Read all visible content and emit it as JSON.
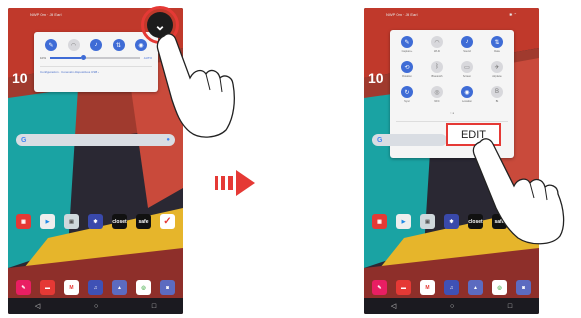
{
  "left_screen": {
    "status_left": "NWP 0m · Jil Earl",
    "clock": "10",
    "quick_settings": [
      {
        "icon": "pencil-icon",
        "on": true
      },
      {
        "icon": "wifi-icon",
        "on": false
      },
      {
        "icon": "sound-icon",
        "on": true
      },
      {
        "icon": "data-icon",
        "on": true
      },
      {
        "icon": "location-icon",
        "on": true
      }
    ],
    "brightness_left": "10%",
    "brightness_right": "AUTO",
    "notification_text": "Configuración · Conexión dispositivos USB ›",
    "expand_label": "⌄"
  },
  "right_screen": {
    "status_left": "NWP 0m · Jil Earl",
    "clock": "10",
    "quick_settings_rows": [
      [
        {
          "icon": "pencil-icon",
          "label": "Capture+",
          "on": true
        },
        {
          "icon": "wifi-icon",
          "label": "Wi-Fi",
          "on": false
        },
        {
          "icon": "sound-icon",
          "label": "Sound",
          "on": true
        },
        {
          "icon": "data-icon",
          "label": "Data",
          "on": true
        }
      ],
      [
        {
          "icon": "rotate-icon",
          "label": "Rotation",
          "on": true
        },
        {
          "icon": "bluetooth-icon",
          "label": "Bluetooth",
          "on": false
        },
        {
          "icon": "screen-icon",
          "label": "Screen",
          "on": false
        },
        {
          "icon": "airplane-icon",
          "label": "Airplane",
          "on": false
        }
      ],
      [
        {
          "icon": "sync-icon",
          "label": "Sync",
          "on": true
        },
        {
          "icon": "nfc-icon",
          "label": "NFC",
          "on": false
        },
        {
          "icon": "location-icon",
          "label": "Location",
          "on": true
        },
        {
          "icon": "b-icon",
          "label": "Bt",
          "on": false
        }
      ]
    ],
    "edit_label": "EDIT",
    "page_dots": "○ ●"
  },
  "home_apps": [
    {
      "icon": "folder-icon",
      "label": "",
      "color": "#e53935"
    },
    {
      "icon": "play-store-icon",
      "label": "",
      "color": "#eeeeee"
    },
    {
      "icon": "gallery-icon",
      "label": "",
      "color": "#cfd8dc"
    },
    {
      "icon": "settings-icon",
      "label": "",
      "color": "#3949ab"
    },
    {
      "icon": "closet-icon",
      "label": "closet",
      "color": "#111111"
    },
    {
      "icon": "safe-icon",
      "label": "safe",
      "color": "#111111"
    },
    {
      "icon": "vodafone-icon",
      "label": "✓",
      "color": "#e53935"
    }
  ],
  "dock_apps": [
    {
      "icon": "pen-icon",
      "color": "#e91e63"
    },
    {
      "icon": "chat-icon",
      "color": "#e53935"
    },
    {
      "icon": "gmail-icon",
      "color": "#e53935"
    },
    {
      "icon": "music-icon",
      "color": "#3f51b5"
    },
    {
      "icon": "photos-icon",
      "color": "#5c6bc0"
    },
    {
      "icon": "chrome-icon",
      "color": "#ffffff"
    },
    {
      "icon": "camera-icon",
      "color": "#5c6bc0"
    }
  ],
  "nav": [
    "◁",
    "○",
    "□"
  ],
  "colors": {
    "highlight": "#e53935",
    "accent": "#3f6cd6"
  }
}
